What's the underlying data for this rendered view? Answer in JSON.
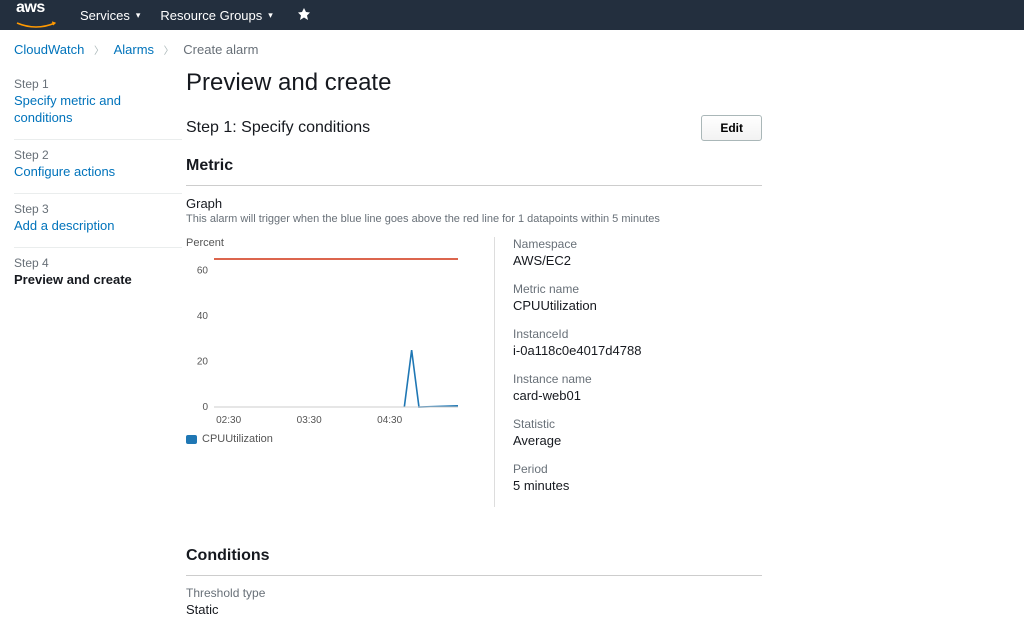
{
  "topnav": {
    "services": "Services",
    "resource_groups": "Resource Groups"
  },
  "breadcrumb": {
    "cloudwatch": "CloudWatch",
    "alarms": "Alarms",
    "current": "Create alarm"
  },
  "sidebar": {
    "step1_label": "Step 1",
    "step1_link": "Specify metric and conditions",
    "step2_label": "Step 2",
    "step2_link": "Configure actions",
    "step3_label": "Step 3",
    "step3_link": "Add a description",
    "step4_label": "Step 4",
    "step4_current": "Preview and create"
  },
  "main": {
    "title": "Preview and create",
    "step_header": "Step 1: Specify conditions",
    "edit": "Edit",
    "metric_section": "Metric",
    "graph_label": "Graph",
    "graph_desc": "This alarm will trigger when the blue line goes above the red line for 1 datapoints within 5 minutes",
    "y_unit": "Percent",
    "legend": "CPUUtilization",
    "meta": {
      "namespace_label": "Namespace",
      "namespace_value": "AWS/EC2",
      "metric_name_label": "Metric name",
      "metric_name_value": "CPUUtilization",
      "instance_id_label": "InstanceId",
      "instance_id_value": "i-0a118c0e4017d4788",
      "instance_name_label": "Instance name",
      "instance_name_value": "card-web01",
      "statistic_label": "Statistic",
      "statistic_value": "Average",
      "period_label": "Period",
      "period_value": "5 minutes"
    },
    "conditions_section": "Conditions",
    "threshold_type_label": "Threshold type",
    "threshold_type_value": "Static"
  },
  "chart_data": {
    "type": "line",
    "ylabel": "Percent",
    "ylim": [
      0,
      65
    ],
    "y_ticks": [
      0,
      20,
      40,
      60
    ],
    "x_ticks": [
      "02:30",
      "03:30",
      "04:30"
    ],
    "threshold": 65,
    "series": [
      {
        "name": "CPUUtilization",
        "color": "#1f77b4",
        "points": [
          {
            "x": 0.78,
            "y": 0
          },
          {
            "x": 0.81,
            "y": 25
          },
          {
            "x": 0.84,
            "y": 0
          },
          {
            "x": 1.0,
            "y": 0.5
          }
        ]
      }
    ]
  }
}
